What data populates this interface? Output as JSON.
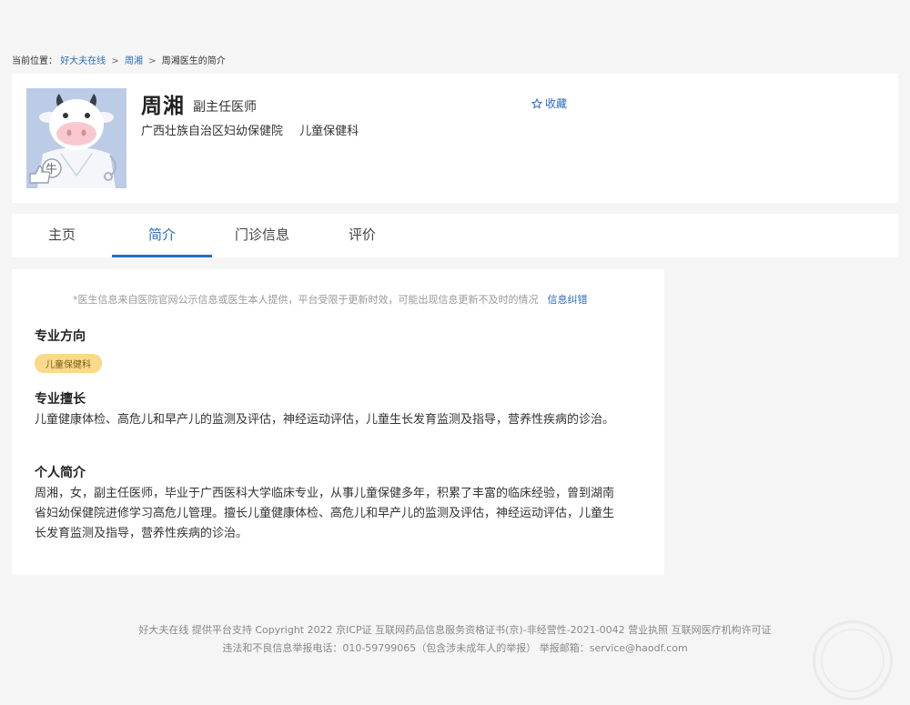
{
  "breadcrumb": {
    "prefix": "当前位置：",
    "items": [
      "好大夫在线",
      "周湘",
      "周湘医生的简介"
    ],
    "sep": ">"
  },
  "doctor": {
    "name": "周湘",
    "title": "副主任医师",
    "hospital": "广西壮族自治区妇幼保健院",
    "department": "儿童保健科",
    "avatar_badge": "牛"
  },
  "favorite": {
    "label": "收藏"
  },
  "tabs": [
    {
      "label": "主页",
      "active": false
    },
    {
      "label": "简介",
      "active": true
    },
    {
      "label": "门诊信息",
      "active": false
    },
    {
      "label": "评价",
      "active": false
    }
  ],
  "intro": {
    "notice": "*医生信息来自医院官网公示信息或医生本人提供，平台受限于更新时效，可能出现信息更新不及时的情况",
    "correction_link": "信息纠错",
    "specialty_title": "专业方向",
    "specialty_tag": "儿童保健科",
    "expertise_title": "专业擅长",
    "expertise_text": "儿童健康体检、高危儿和早产儿的监测及评估，神经运动评估，儿童生长发育监测及指导，营养性疾病的诊治。",
    "bio_title": "个人简介",
    "bio_text": "周湘，女，副主任医师，毕业于广西医科大学临床专业，从事儿童保健多年，积累了丰富的临床经验，曾到湖南省妇幼保健院进修学习高危儿管理。擅长儿童健康体检、高危儿和早产儿的监测及评估，神经运动评估，儿童生长发育监测及指导，营养性疾病的诊治。"
  },
  "footer": {
    "line1": "好大夫在线 提供平台支持 Copyright 2022 京ICP证 互联网药品信息服务资格证书(京)-非经营性-2021-0042 营业执照 互联网医疗机构许可证",
    "line2": "违法和不良信息举报电话：010-59799065（包含涉未成年人的举报） 举报邮箱：service@haodf.com"
  },
  "colors": {
    "accent": "#2a6bbf",
    "tag_bg": "#fbd98a",
    "avatar_bg": "#bccbe6"
  }
}
